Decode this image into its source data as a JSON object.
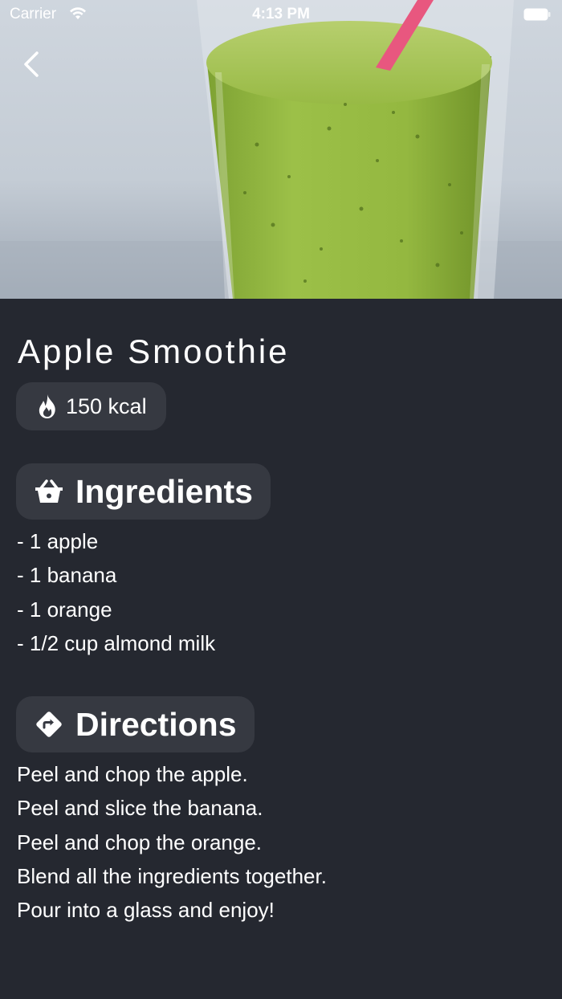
{
  "status_bar": {
    "carrier": "Carrier",
    "time": "4:13 PM",
    "wifi_icon": "wifi-icon",
    "battery_icon": "battery-icon"
  },
  "navigation": {
    "back_icon": "chevron-left-icon"
  },
  "hero": {
    "image": "green-smoothie-glass-with-pink-straw"
  },
  "recipe": {
    "title": "Apple Smoothie",
    "calories": "150 kcal",
    "calorie_icon": "fire-icon"
  },
  "ingredients": {
    "heading": "Ingredients",
    "icon": "basket-icon",
    "items": [
      "- 1 apple",
      "- 1 banana",
      "- 1 orange",
      "- 1/2 cup almond milk"
    ]
  },
  "directions": {
    "heading": "Directions",
    "icon": "directions-sign-icon",
    "steps": [
      "Peel and chop the apple.",
      "Peel and slice the banana.",
      "Peel and chop the orange.",
      "Blend all the ingredients together.",
      "Pour into a glass and enjoy!"
    ]
  },
  "colors": {
    "background": "#252830",
    "chip": "#363941",
    "text": "#ffffff",
    "smoothie_green": "#8db33f",
    "straw_pink": "#e8577f"
  }
}
